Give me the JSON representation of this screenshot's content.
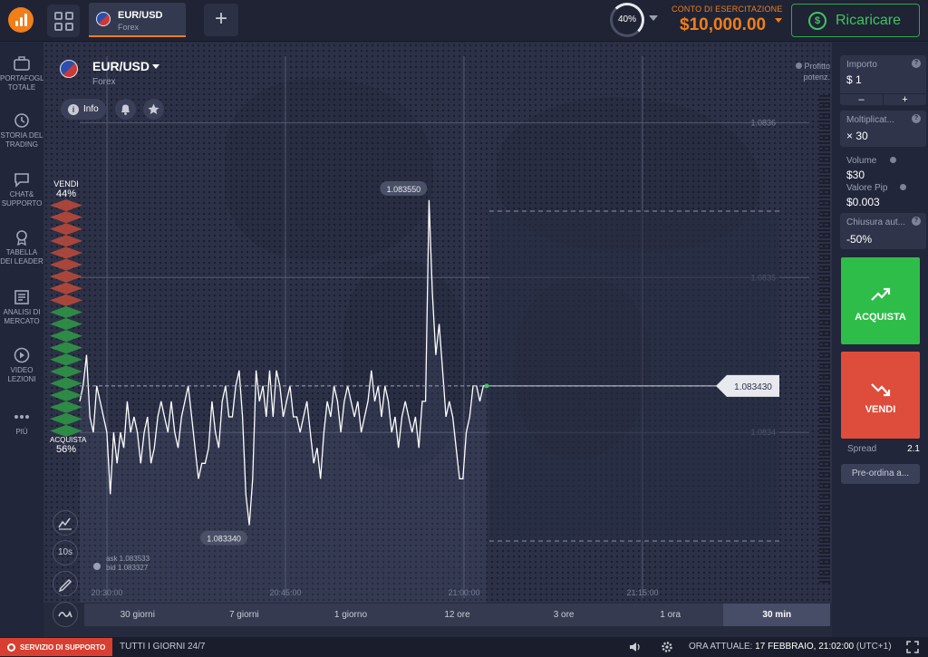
{
  "header": {
    "asset_tab": {
      "title": "EUR/USD",
      "subtitle": "Forex"
    },
    "add_tab_label": "+",
    "profit_percent": "40%",
    "account": {
      "label": "CONTO DI ESERCITAZIONE",
      "balance": "$10,000.00"
    },
    "recharge_label": "Ricaricare"
  },
  "sidebar": {
    "items": [
      {
        "label": "PORTAFOGLIO TOTALE",
        "icon": "briefcase-icon"
      },
      {
        "label": "STORIA DEL TRADING",
        "icon": "history-icon"
      },
      {
        "label": "CHAT& SUPPORTO",
        "icon": "chat-icon"
      },
      {
        "label": "TABELLA DEI LEADER",
        "icon": "medal-icon"
      },
      {
        "label": "ANALISI DI MERCATO",
        "icon": "newspaper-icon"
      },
      {
        "label": "VIDEO LEZIONI",
        "icon": "play-icon"
      },
      {
        "label": "PIÙ",
        "icon": "more-icon"
      }
    ]
  },
  "chart_header": {
    "asset": "EUR/USD",
    "category": "Forex",
    "info_label": "Info",
    "profit_label": "Profitto potenz."
  },
  "sentiment": {
    "sell_label": "VENDI",
    "sell_pct": "44%",
    "buy_label": "ACQUISTA",
    "buy_pct": "56%"
  },
  "tools": {
    "timer_label": "10s"
  },
  "quote": {
    "ask": "ask 1.083533",
    "bid": "bid 1.083327"
  },
  "chart_data": {
    "type": "line",
    "x_ticks": [
      "20:30:00",
      "20:45:00",
      "21:00:00",
      "21:15:00"
    ],
    "y_ticks": [
      "1.0836",
      "1.0835",
      "1.0834"
    ],
    "ylim": [
      1.08329,
      1.08365
    ],
    "annotations": {
      "high": "1.083550",
      "low": "1.083340",
      "current": "1.083430"
    },
    "current_value": 1.08343,
    "series": [
      {
        "values": [
          1.08342,
          1.08343,
          1.08345,
          1.08341,
          1.0834,
          1.08343,
          1.08342,
          1.08341,
          1.0834,
          1.08336,
          1.0834,
          1.08338,
          1.0834,
          1.08339,
          1.08342,
          1.0834,
          1.08341,
          1.0834,
          1.08338,
          1.0834,
          1.08341,
          1.08338,
          1.08339,
          1.08341,
          1.08342,
          1.08341,
          1.0834,
          1.08342,
          1.0834,
          1.08339,
          1.08341,
          1.08342,
          1.08343,
          1.08341,
          1.08339,
          1.08337,
          1.08338,
          1.08338,
          1.08339,
          1.08342,
          1.0834,
          1.08339,
          1.08342,
          1.08343,
          1.08341,
          1.08341,
          1.08343,
          1.08344,
          1.08341,
          1.08336,
          1.08334,
          1.08337,
          1.08344,
          1.08342,
          1.08343,
          1.08341,
          1.08344,
          1.08341,
          1.08344,
          1.08343,
          1.08341,
          1.08342,
          1.08343,
          1.08341,
          1.08341,
          1.0834,
          1.08341,
          1.08342,
          1.0834,
          1.08338,
          1.08339,
          1.08337,
          1.0834,
          1.08342,
          1.08341,
          1.08343,
          1.08342,
          1.0834,
          1.08342,
          1.08343,
          1.08342,
          1.08341,
          1.08342,
          1.0834,
          1.08341,
          1.08342,
          1.08344,
          1.08342,
          1.08343,
          1.08341,
          1.08343,
          1.08342,
          1.0834,
          1.08341,
          1.08339,
          1.08341,
          1.08342,
          1.08341,
          1.0834,
          1.08341,
          1.08339,
          1.08342,
          1.08342,
          1.08355,
          1.08349,
          1.08345,
          1.08347,
          1.08344,
          1.08341,
          1.08342,
          1.08341,
          1.08339,
          1.08337,
          1.08337,
          1.0834,
          1.08341,
          1.08343,
          1.08343,
          1.08342,
          1.08343,
          1.08343
        ]
      }
    ]
  },
  "period_tabs": [
    "30 giorni",
    "7 giorni",
    "1 giorno",
    "12 ore",
    "3 ore",
    "1 ora",
    "30 min"
  ],
  "right_panel": {
    "amount": {
      "label": "Importo",
      "value": "$ 1",
      "minus": "–",
      "plus": "+"
    },
    "multiplier": {
      "label": "Moltiplicat...",
      "value": "× 30"
    },
    "volume": {
      "label": "Volume",
      "value": "$30"
    },
    "pip": {
      "label": "Valore Pip",
      "value": "$0.003"
    },
    "auto_close": {
      "label": "Chiusura aut...",
      "value": "-50%"
    },
    "buy_label": "ACQUISTA",
    "sell_label": "VENDI",
    "spread": {
      "label": "Spread",
      "value": "2.1"
    },
    "preorder_label": "Pre-ordina a..."
  },
  "footer": {
    "support_label": "SERVIZIO DI SUPPORTO",
    "availability": "TUTTI I GIORNI 24/7",
    "time_label": "ORA ATTUALE:",
    "time_value": "17 FEBBRAIO, 21:02:00",
    "timezone": "(UTC+1)"
  },
  "colors": {
    "accent": "#f07e19",
    "buy": "#2ebd49",
    "sell": "#de4d3b",
    "background": "#252a3d"
  }
}
